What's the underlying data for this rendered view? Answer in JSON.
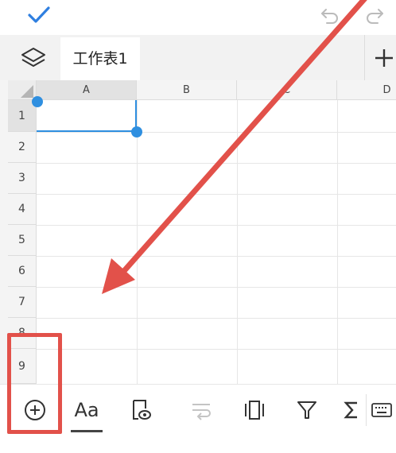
{
  "topbar": {
    "confirm_icon": "checkmark-icon",
    "undo_icon": "undo-icon",
    "redo_icon": "redo-icon"
  },
  "sheetbar": {
    "layers_icon": "layers-icon",
    "active_sheet": "工作表1",
    "add_icon": "plus-icon"
  },
  "grid": {
    "columns": [
      "A",
      "B",
      "C",
      "D"
    ],
    "rows": [
      "1",
      "2",
      "3",
      "4",
      "5",
      "6",
      "7",
      "8",
      "9"
    ],
    "selected_cell": "A1"
  },
  "toolbar": {
    "items": [
      {
        "name": "insert",
        "icon": "circle-plus-icon"
      },
      {
        "name": "text-format",
        "label": "Aa",
        "icon": "font-format-icon"
      },
      {
        "name": "preview",
        "icon": "doc-eye-icon"
      },
      {
        "name": "wrap",
        "icon": "wrap-text-icon"
      },
      {
        "name": "freeze",
        "icon": "column-freeze-icon"
      },
      {
        "name": "filter",
        "icon": "filter-icon"
      },
      {
        "name": "sum",
        "icon": "sigma-icon"
      },
      {
        "name": "keyboard",
        "icon": "keyboard-icon"
      }
    ]
  },
  "colors": {
    "accent": "#2f8fe0",
    "annotation": "#e2514a",
    "header_bg": "#f4f4f4"
  }
}
